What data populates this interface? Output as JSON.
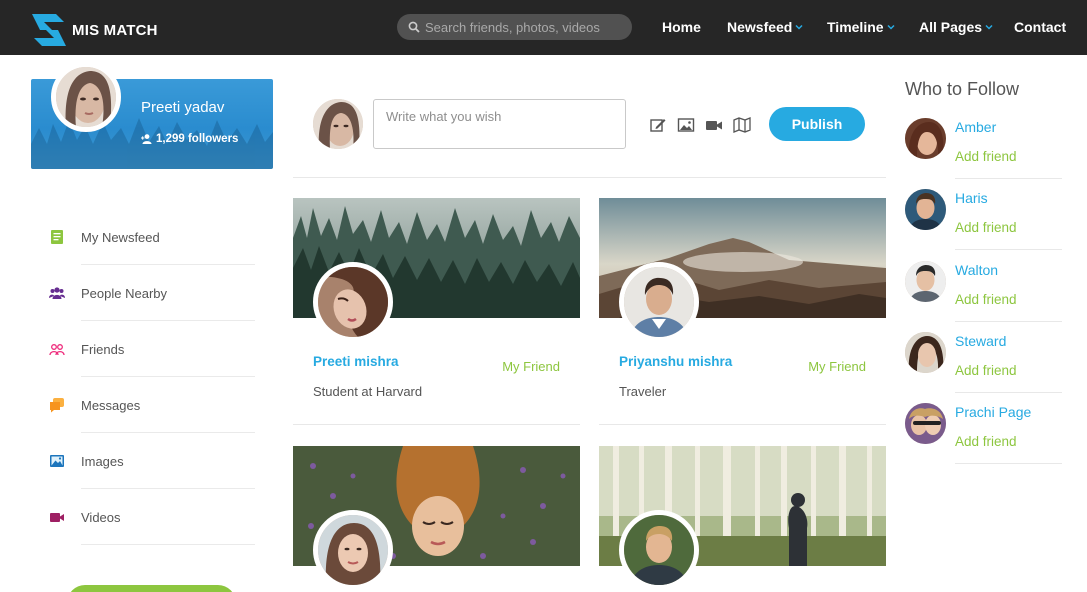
{
  "colors": {
    "navbar": "#262626",
    "accent_blue": "#27aae1",
    "accent_green": "#8dc63f"
  },
  "brand": {
    "name": "MIS MATCH",
    "logo_icon": "logo-icon"
  },
  "search": {
    "placeholder": "Search friends, photos, videos",
    "icon": "search-icon"
  },
  "nav": {
    "home": "Home",
    "newsfeed": "Newsfeed",
    "timeline": "Timeline",
    "all_pages": "All Pages",
    "contact": "Contact"
  },
  "profile": {
    "name": "Preeti yadav",
    "followers": "1,299 followers",
    "followers_icon": "add-user-icon"
  },
  "sidebar": {
    "items": [
      {
        "label": "My Newsfeed",
        "icon": "newsfeed-icon",
        "color": "#8dc63f"
      },
      {
        "label": "People Nearby",
        "icon": "people-icon",
        "color": "#662d91"
      },
      {
        "label": "Friends",
        "icon": "friends-icon",
        "color": "#ee2a7b"
      },
      {
        "label": "Messages",
        "icon": "messages-icon",
        "color": "#f7941d"
      },
      {
        "label": "Images",
        "icon": "image-icon",
        "color": "#1c75bc"
      },
      {
        "label": "Videos",
        "icon": "video-icon",
        "color": "#9e1f63"
      }
    ]
  },
  "composer": {
    "placeholder": "Write what you wish",
    "publish_label": "Publish",
    "tools": [
      "edit-icon",
      "image-icon",
      "video-camera-icon",
      "map-icon"
    ]
  },
  "friends": [
    {
      "name": "Preeti mishra",
      "status": "My Friend",
      "subtitle": "Student at Harvard",
      "cover": "forest"
    },
    {
      "name": "Priyanshu mishra",
      "status": "My Friend",
      "subtitle": "Traveler",
      "cover": "volcano"
    },
    {
      "name": "",
      "status": "",
      "subtitle": "",
      "cover": "lavender"
    },
    {
      "name": "",
      "status": "",
      "subtitle": "",
      "cover": "woods"
    }
  ],
  "who_to_follow": {
    "title": "Who to Follow",
    "items": [
      {
        "name": "Amber",
        "action": "Add friend"
      },
      {
        "name": "Haris",
        "action": "Add friend"
      },
      {
        "name": "Walton",
        "action": "Add friend"
      },
      {
        "name": "Steward",
        "action": "Add friend"
      },
      {
        "name": "Prachi Page",
        "action": "Add friend"
      }
    ]
  }
}
